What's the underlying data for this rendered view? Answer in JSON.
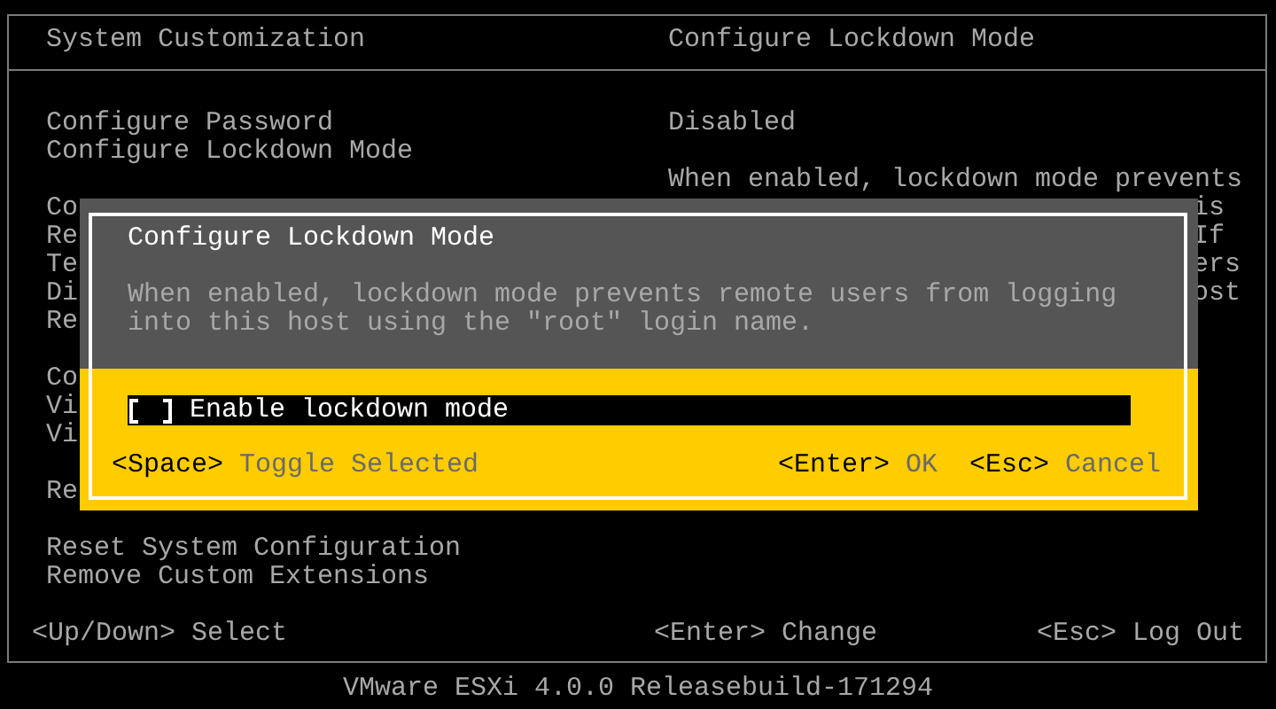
{
  "header": {
    "title": "System Customization",
    "detail_title": "Configure Lockdown Mode"
  },
  "menu_groups": [
    [
      "Configure Password",
      "Configure Lockdown Mode"
    ],
    [
      "Co",
      "Re",
      "Te",
      "Di",
      "Re"
    ],
    [
      "Co",
      "Vi",
      "Vi"
    ],
    [
      "Re"
    ],
    [
      "Reset System Configuration",
      "Remove Custom Extensions"
    ]
  ],
  "detail": {
    "status": "Disabled",
    "description": "When enabled, lockdown mode prevents",
    "covered_fragments": [
      "is",
      "If",
      "ers",
      "ost"
    ]
  },
  "footer_hints": [
    "<Up/Down> Select",
    "<Enter> Change",
    "<Esc> Log Out"
  ],
  "version": "VMware ESXi 4.0.0 Releasebuild-171294",
  "dialog": {
    "title": "Configure Lockdown Mode",
    "message_lines": [
      "When enabled, lockdown mode prevents remote users from logging",
      "into this host using the \"root\" login name."
    ],
    "options": [
      {
        "label": "Enable lockdown mode",
        "checked": false,
        "selected": true
      }
    ],
    "left_hints": [
      {
        "key": "<Space>",
        "action": "Toggle Selected"
      }
    ],
    "right_hints": [
      {
        "key": "<Enter>",
        "action": "OK"
      },
      {
        "key": "<Esc>",
        "action": "Cancel"
      }
    ]
  }
}
